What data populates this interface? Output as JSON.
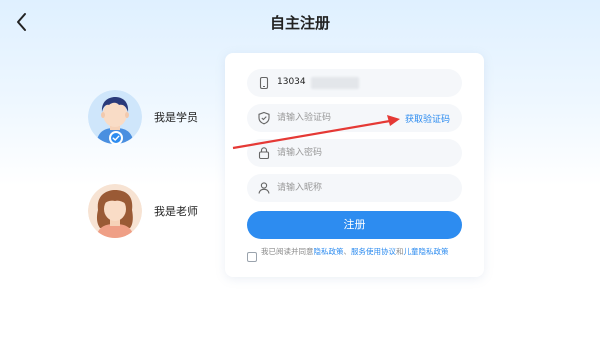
{
  "header": {
    "title": "自主注册",
    "back_icon": "chevron-left-icon"
  },
  "roles": [
    {
      "label": "我是学员",
      "selected": true,
      "avatar": "student-avatar"
    },
    {
      "label": "我是老师",
      "selected": false,
      "avatar": "teacher-avatar"
    }
  ],
  "form": {
    "phone_value": "13034",
    "code_placeholder": "请输入验证码",
    "get_code_label": "获取验证码",
    "password_placeholder": "请输入密码",
    "nickname_placeholder": "请输入昵称",
    "submit_label": "注册"
  },
  "agreement": {
    "prefix": "我已阅读并同意",
    "privacy": "隐私政策",
    "sep": "、",
    "service": "服务使用协议",
    "and": "和",
    "child_privacy": "儿童隐私政策"
  },
  "colors": {
    "accent": "#2d8cf0",
    "annotation_arrow": "#e53935"
  }
}
